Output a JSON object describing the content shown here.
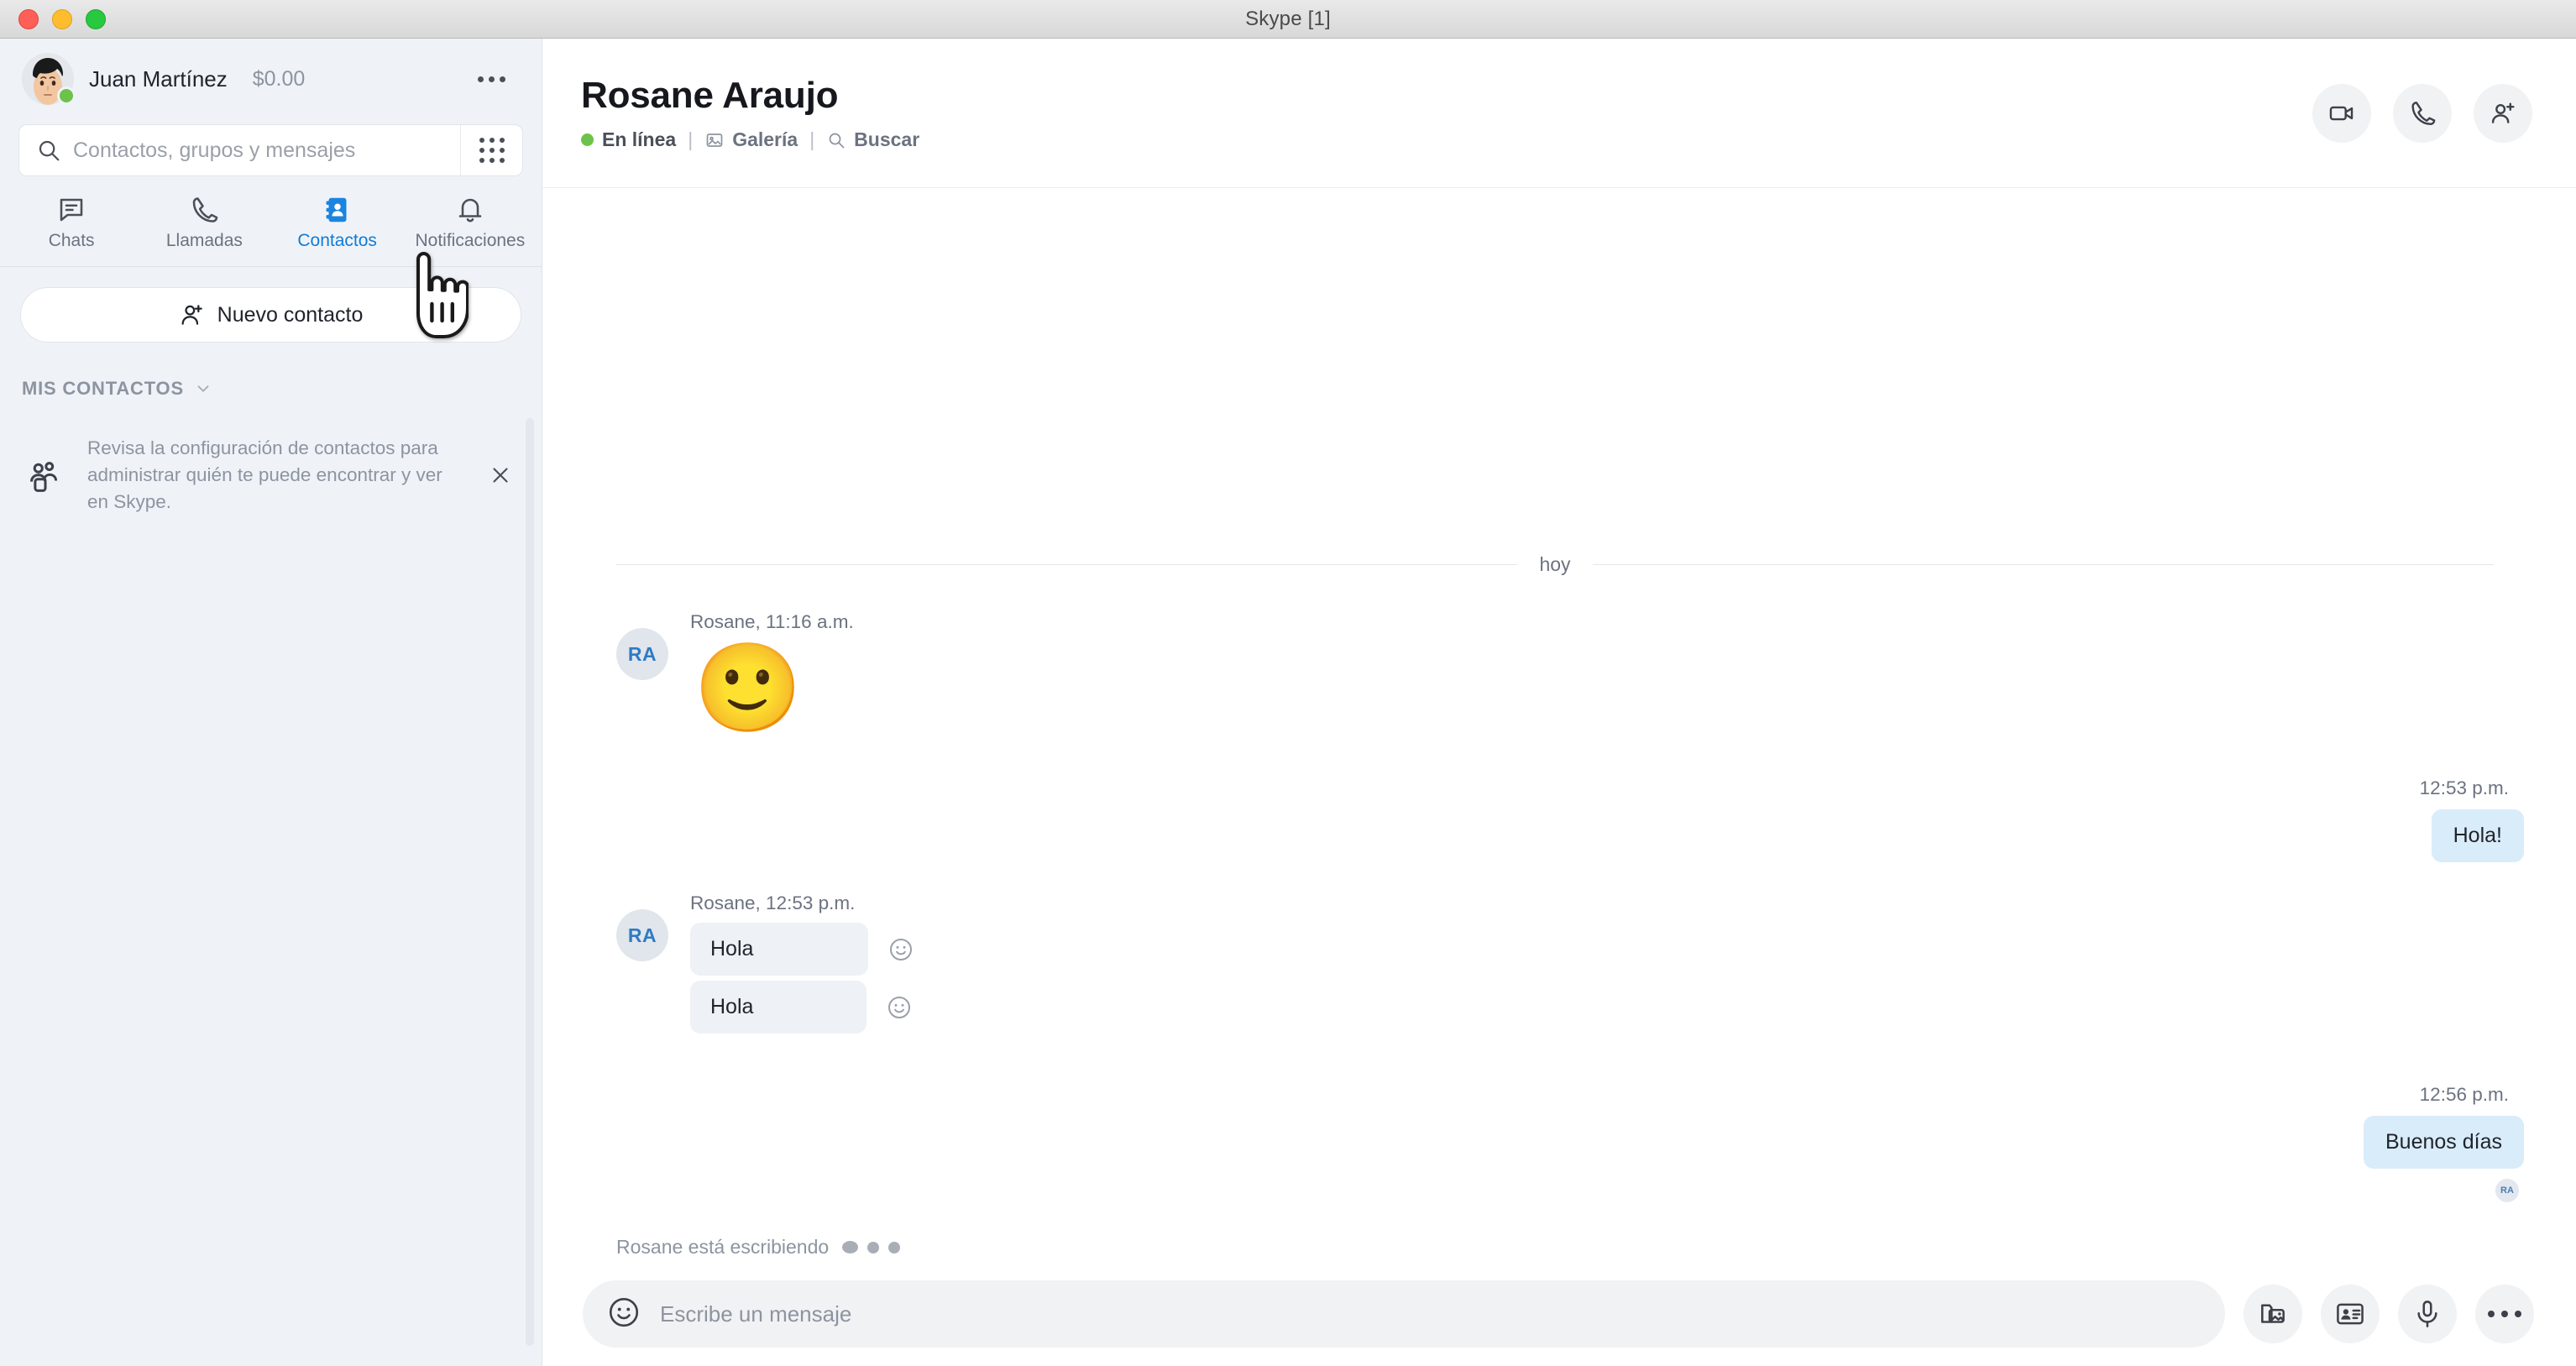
{
  "window": {
    "title": "Skype [1]",
    "traffic_lights": [
      "close",
      "minimize",
      "maximize"
    ]
  },
  "sidebar": {
    "profile": {
      "name": "Juan Martínez",
      "credit": "$0.00",
      "presence": "online",
      "more_label": "…"
    },
    "search": {
      "placeholder": "Contactos, grupos y mensajes",
      "value": "",
      "dialpad_icon": "dialpad-icon"
    },
    "tabs": [
      {
        "label": "Chats",
        "icon": "chat-icon",
        "active": false
      },
      {
        "label": "Llamadas",
        "icon": "phone-icon",
        "active": false
      },
      {
        "label": "Contactos",
        "icon": "contacts-book-icon",
        "active": true
      },
      {
        "label": "Notificaciones",
        "icon": "bell-icon",
        "active": false
      }
    ],
    "new_contact_label": "Nuevo contacto",
    "section_header": "MIS CONTACTOS",
    "info_card": {
      "text": "Revisa la configuración de contactos para administrar quién te puede encontrar y ver en Skype.",
      "icon": "people-group-icon",
      "close_label": "✕"
    }
  },
  "chat": {
    "title": "Rosane Araujo",
    "status": "En línea",
    "links": [
      {
        "label": "Galería",
        "icon": "gallery-icon"
      },
      {
        "label": "Buscar",
        "icon": "search-icon"
      }
    ],
    "separator": "|",
    "actions": [
      {
        "name": "video-call",
        "icon": "video-camera-icon"
      },
      {
        "name": "voice-call",
        "icon": "phone-icon"
      },
      {
        "name": "add-people",
        "icon": "add-person-icon"
      }
    ],
    "day_divider": "hoy",
    "messages": [
      {
        "direction": "in",
        "avatar": "RA",
        "meta": "Rosane, 11:16 a.m.",
        "type": "emoji",
        "emoji": "🙂"
      },
      {
        "direction": "out",
        "time": "12:53 p.m.",
        "type": "text",
        "text": "Hola!"
      },
      {
        "direction": "in",
        "avatar": "RA",
        "meta": "Rosane, 12:53 p.m.",
        "type": "text-group",
        "texts": [
          "Hola",
          "Hola"
        ],
        "reaction_icon": "smiley-react-icon"
      },
      {
        "direction": "out",
        "time": "12:56 p.m.",
        "type": "text",
        "text": "Buenos días",
        "read_receipt": "RA"
      }
    ],
    "typing": {
      "text": "Rosane está escribiendo",
      "dots": 3
    }
  },
  "composer": {
    "emoji_icon": "smiley-icon",
    "placeholder": "Escribe un mensaje",
    "value": "",
    "actions": [
      {
        "name": "attach-media",
        "icon": "media-gallery-icon"
      },
      {
        "name": "send-contact",
        "icon": "contact-card-icon"
      },
      {
        "name": "record-audio",
        "icon": "microphone-icon"
      },
      {
        "name": "more-options",
        "icon": "ellipsis-icon"
      }
    ]
  },
  "colors": {
    "sidebar_bg": "#eff3f8",
    "accent_blue": "#0f7bd8",
    "bubble_in": "#eef1f6",
    "bubble_out": "#d9ecfa",
    "presence_green": "#6cc24a",
    "muted_text": "#6b7280"
  }
}
